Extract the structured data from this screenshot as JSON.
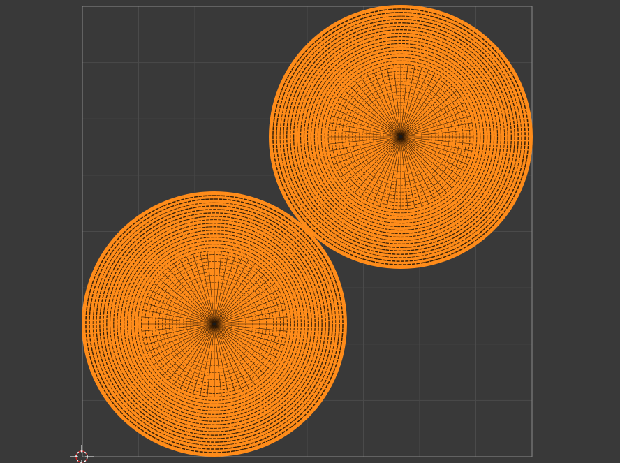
{
  "editor": {
    "background_color": "#393939",
    "grid_line_color": "#4a4a4a",
    "bounds_color": "#8a8a8a",
    "grid_divisions": 8
  },
  "mesh": {
    "selected_color": "#ff8c1a",
    "edge_color": "#ff8c1a",
    "rings": 38,
    "segments": 64,
    "objects": [
      "disc-upper-right",
      "disc-lower-left"
    ]
  },
  "cursor_3d": {
    "icon": "crosshair-cursor-icon",
    "primary_color": "#ffffff",
    "accent_color": "#d02020"
  }
}
